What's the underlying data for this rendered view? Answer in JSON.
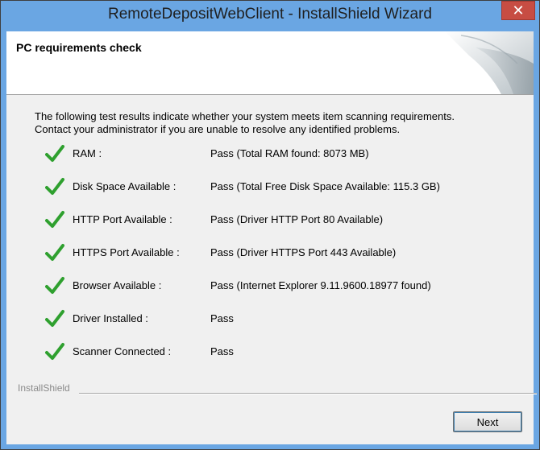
{
  "window": {
    "title": "RemoteDepositWebClient - InstallShield Wizard",
    "close_glyph": "✕",
    "accent_color": "#6aa6e3"
  },
  "header": {
    "title": "PC requirements check"
  },
  "intro": {
    "line1": "The following test results indicate whether your system meets item scanning requirements.",
    "line2": "Contact your administrator if you are unable to resolve any identified problems."
  },
  "checks": [
    {
      "label": "RAM :",
      "result": "Pass (Total RAM found: 8073 MB)",
      "status_icon": "check-icon"
    },
    {
      "label": "Disk Space Available :",
      "result": "Pass (Total Free Disk Space Available: 115.3 GB)",
      "status_icon": "check-icon"
    },
    {
      "label": "HTTP Port Available :",
      "result": "Pass (Driver HTTP Port 80 Available)",
      "status_icon": "check-icon"
    },
    {
      "label": "HTTPS Port Available :",
      "result": "Pass (Driver HTTPS Port 443 Available)",
      "status_icon": "check-icon"
    },
    {
      "label": "Browser Available :",
      "result": "Pass (Internet Explorer 9.11.9600.18977 found)",
      "status_icon": "check-icon"
    },
    {
      "label": "Driver Installed :",
      "result": "Pass",
      "status_icon": "check-icon"
    },
    {
      "label": "Scanner Connected :",
      "result": "Pass",
      "status_icon": "check-icon"
    }
  ],
  "footer": {
    "brand": "InstallShield",
    "next_label": "Next"
  },
  "colors": {
    "check": "#2fa02f",
    "close": "#c74d43"
  }
}
